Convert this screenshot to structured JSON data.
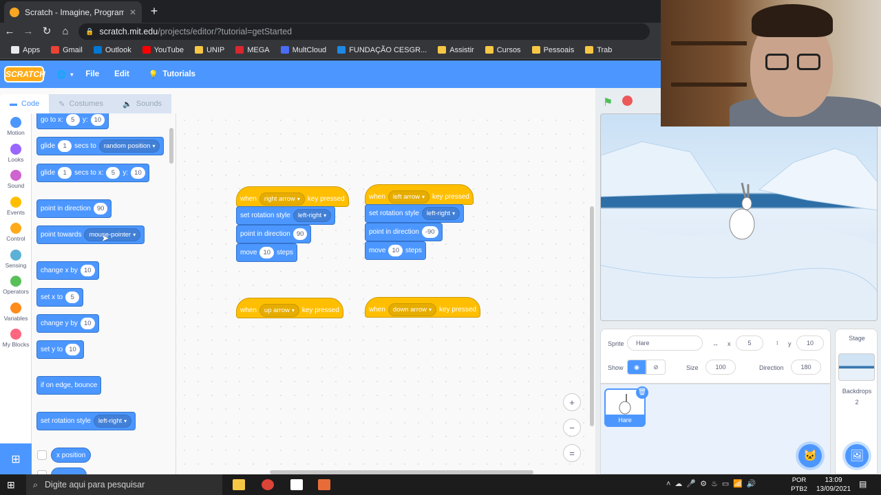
{
  "browser": {
    "tab_title": "Scratch - Imagine, Program, Share",
    "url_host": "scratch.mit.edu",
    "url_path": "/projects/editor/?tutorial=getStarted",
    "bookmarks": [
      {
        "label": "Apps",
        "color": "#e8eaed"
      },
      {
        "label": "Gmail",
        "color": "#ea4335"
      },
      {
        "label": "Outlook",
        "color": "#0078d4"
      },
      {
        "label": "YouTube",
        "color": "#ff0000"
      },
      {
        "label": "UNIP",
        "color": "#f6c744"
      },
      {
        "label": "MEGA",
        "color": "#d9272e"
      },
      {
        "label": "MultCloud",
        "color": "#4a6cf7"
      },
      {
        "label": "FUNDAÇÃO CESGR...",
        "color": "#1e88e5"
      },
      {
        "label": "Assistir",
        "color": "#f6c744"
      },
      {
        "label": "Cursos",
        "color": "#f6c744"
      },
      {
        "label": "Pessoais",
        "color": "#f6c744"
      },
      {
        "label": "Trab",
        "color": "#f6c744"
      }
    ]
  },
  "menubar": {
    "logo": "SCRATCH",
    "file": "File",
    "edit": "Edit",
    "tutorials": "Tutorials"
  },
  "editor_tabs": {
    "code": "Code",
    "costumes": "Costumes",
    "sounds": "Sounds"
  },
  "categories": [
    {
      "label": "Motion",
      "color": "#4c97ff"
    },
    {
      "label": "Looks",
      "color": "#9966ff"
    },
    {
      "label": "Sound",
      "color": "#cf63cf"
    },
    {
      "label": "Events",
      "color": "#ffbf00"
    },
    {
      "label": "Control",
      "color": "#ffab19"
    },
    {
      "label": "Sensing",
      "color": "#5cb1d6"
    },
    {
      "label": "Operators",
      "color": "#59c059"
    },
    {
      "label": "Variables",
      "color": "#ff8c1a"
    },
    {
      "label": "My Blocks",
      "color": "#ff6680"
    }
  ],
  "palette": {
    "goto": {
      "t1": "go to x:",
      "x": "5",
      "t2": "y:",
      "y": "10"
    },
    "glide_random": {
      "t1": "glide",
      "n": "1",
      "t2": "secs to",
      "dd": "random position"
    },
    "glide_xy": {
      "t1": "glide",
      "n": "1",
      "t2": "secs to x:",
      "x": "5",
      "t3": "y:",
      "y": "10"
    },
    "point_dir": {
      "t1": "point in direction",
      "n": "90"
    },
    "point_towards": {
      "t1": "point towards",
      "dd": "mouse-pointer"
    },
    "change_x": {
      "t1": "change x by",
      "n": "10"
    },
    "set_x": {
      "t1": "set x to",
      "n": "5"
    },
    "change_y": {
      "t1": "change y by",
      "n": "10"
    },
    "set_y": {
      "t1": "set y to",
      "n": "10"
    },
    "bounce": {
      "t1": "if on edge, bounce"
    },
    "rot_style": {
      "t1": "set rotation style",
      "dd": "left-right"
    },
    "xpos": {
      "t1": "x position"
    }
  },
  "scripts": {
    "right": {
      "when": "when",
      "key": "right arrow",
      "pressed": "key pressed",
      "rot": "set rotation style",
      "rot_dd": "left-right",
      "dir": "point in direction",
      "dir_n": "90",
      "move": "move",
      "move_n": "10",
      "steps": "steps"
    },
    "left": {
      "when": "when",
      "key": "left arrow",
      "pressed": "key pressed",
      "rot": "set rotation style",
      "rot_dd": "left-right",
      "dir": "point in direction",
      "dir_n": "-90",
      "move": "move",
      "move_n": "10",
      "steps": "steps"
    },
    "up": {
      "when": "when",
      "key": "up arrow",
      "pressed": "key pressed"
    },
    "down": {
      "when": "when",
      "key": "down arrow",
      "pressed": "key pressed"
    }
  },
  "sprite_info": {
    "sprite_label": "Sprite",
    "sprite_name": "Hare",
    "x_label": "x",
    "x": "5",
    "y_label": "y",
    "y": "10",
    "show_label": "Show",
    "size_label": "Size",
    "size": "100",
    "direction_label": "Direction",
    "direction": "180"
  },
  "sprite_list": [
    {
      "name": "Hare"
    }
  ],
  "stage_panel": {
    "title": "Stage",
    "backdrops_label": "Backdrops",
    "backdrops_count": "2"
  },
  "taskbar": {
    "search_placeholder": "Digite aqui para pesquisar",
    "lang1": "POR",
    "lang2": "PTB2",
    "time": "13:09",
    "date": "13/09/2021"
  }
}
